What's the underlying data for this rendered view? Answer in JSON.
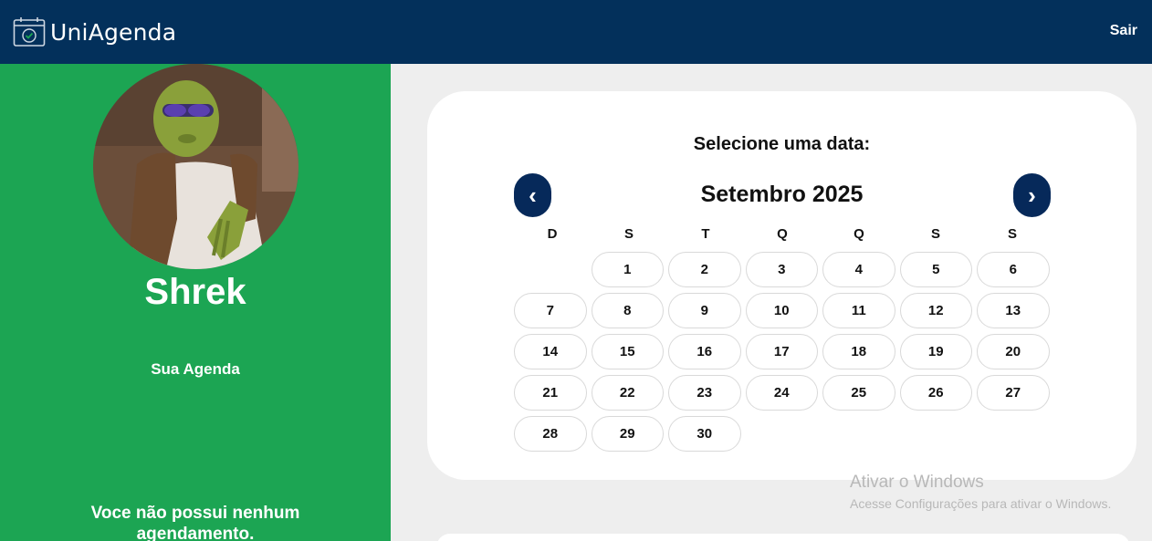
{
  "header": {
    "brand": "UniAgenda",
    "logout_label": "Sair",
    "icons": {
      "logo": "calendar-check-icon"
    }
  },
  "sidebar": {
    "user_name": "Shrek",
    "agenda_title": "Sua Agenda",
    "empty_message": "Voce não possui nenhum agendamento."
  },
  "calendar": {
    "title": "Selecione uma data:",
    "month_label": "Setembro 2025",
    "prev_label": "‹",
    "next_label": "›",
    "weekdays": [
      "D",
      "S",
      "T",
      "Q",
      "Q",
      "S",
      "S"
    ],
    "days": [
      "",
      "1",
      "2",
      "3",
      "4",
      "5",
      "6",
      "7",
      "8",
      "9",
      "10",
      "11",
      "12",
      "13",
      "14",
      "15",
      "16",
      "17",
      "18",
      "19",
      "20",
      "21",
      "22",
      "23",
      "24",
      "25",
      "26",
      "27",
      "28",
      "29",
      "30"
    ]
  },
  "watermark": {
    "title": "Ativar o Windows",
    "subtitle": "Acesse Configurações para ativar o Windows."
  },
  "colors": {
    "topbar": "#03305b",
    "sidebar": "#1ca553",
    "nav_button": "#06295a",
    "background": "#eeeeee"
  }
}
